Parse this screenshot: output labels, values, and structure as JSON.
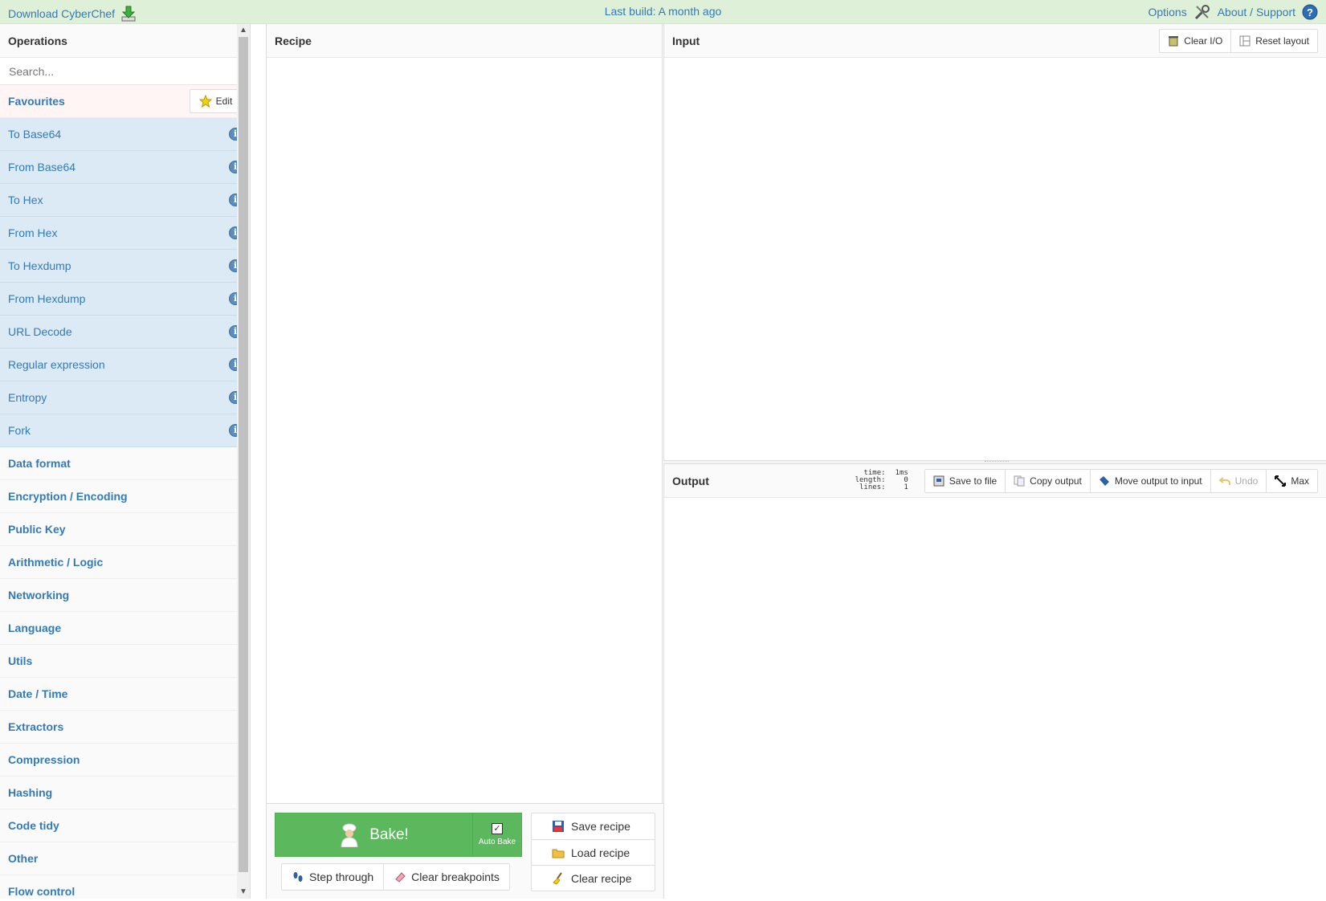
{
  "banner": {
    "download_label": "Download CyberChef",
    "build_label": "Last build: A month ago",
    "options_label": "Options",
    "about_label": "About / Support"
  },
  "operations": {
    "title": "Operations",
    "search_placeholder": "Search...",
    "favourites_label": "Favourites",
    "edit_label": "Edit",
    "favourites": [
      "To Base64",
      "From Base64",
      "To Hex",
      "From Hex",
      "To Hexdump",
      "From Hexdump",
      "URL Decode",
      "Regular expression",
      "Entropy",
      "Fork"
    ],
    "categories": [
      "Data format",
      "Encryption / Encoding",
      "Public Key",
      "Arithmetic / Logic",
      "Networking",
      "Language",
      "Utils",
      "Date / Time",
      "Extractors",
      "Compression",
      "Hashing",
      "Code tidy",
      "Other",
      "Flow control"
    ]
  },
  "recipe": {
    "title": "Recipe",
    "bake_label": "Bake!",
    "auto_bake_label": "Auto Bake",
    "auto_bake_checked": true,
    "step_label": "Step through",
    "clear_breakpoints_label": "Clear breakpoints",
    "save_label": "Save recipe",
    "load_label": "Load recipe",
    "clear_label": "Clear recipe"
  },
  "input": {
    "title": "Input",
    "clear_io_label": "Clear I/O",
    "reset_layout_label": "Reset layout",
    "value": ""
  },
  "output": {
    "title": "Output",
    "stats": {
      "time_key": "time:",
      "time_val": "1ms",
      "length_key": "length:",
      "length_val": "0",
      "lines_key": "lines:",
      "lines_val": "1"
    },
    "save_label": "Save to file",
    "copy_label": "Copy output",
    "move_label": "Move output to input",
    "undo_label": "Undo",
    "max_label": "Max",
    "value": ""
  },
  "colors": {
    "banner_bg": "#dff0d8",
    "link": "#337ab7",
    "favourite_bg": "#dbeaf5",
    "bake_green": "#5cb85c"
  }
}
